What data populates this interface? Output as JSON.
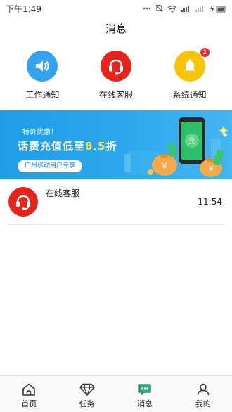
{
  "status_bar": {
    "time": "下午1:49"
  },
  "header": {
    "title": "消息"
  },
  "quick_actions": [
    {
      "label": "工作通知",
      "icon": "speaker-icon",
      "color": "#35a2f0"
    },
    {
      "label": "在线客服",
      "icon": "headset-icon",
      "color": "#e3251c"
    },
    {
      "label": "系统通知",
      "icon": "bell-icon",
      "color": "#f6c408",
      "badge": "2"
    }
  ],
  "banner": {
    "promo_small": "特价优惠！",
    "promo_prefix": "话费充值低至",
    "promo_discount": "8.5",
    "promo_suffix": "折",
    "pill_text": "广州移动用户专享",
    "phone_char": "充",
    "coin_char": "￥"
  },
  "messages": [
    {
      "title": "在线客服",
      "time": "11:54",
      "icon": "headset-icon"
    }
  ],
  "tabbar": [
    {
      "label": "首页",
      "icon": "home-icon"
    },
    {
      "label": "任务",
      "icon": "diamond-icon"
    },
    {
      "label": "消息",
      "icon": "message-icon",
      "active": true
    },
    {
      "label": "我的",
      "icon": "user-icon"
    }
  ]
}
